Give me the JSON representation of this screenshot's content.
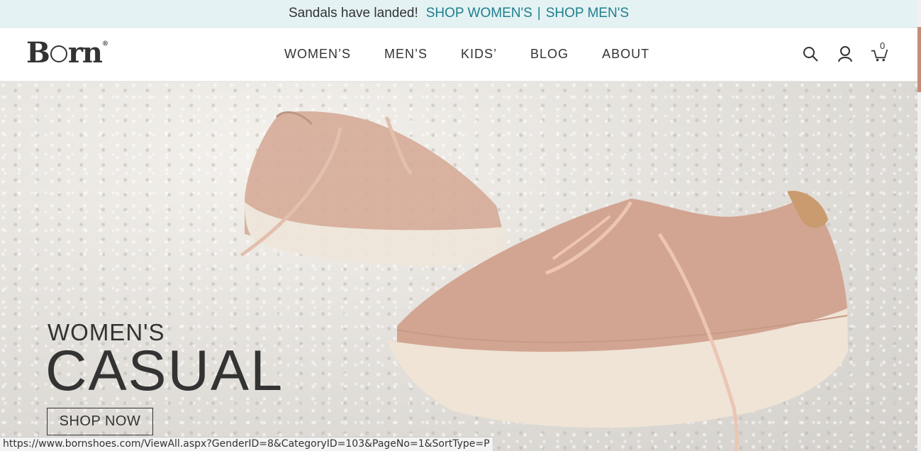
{
  "promo": {
    "message": "Sandals have landed!",
    "shop_womens": "SHOP WOMEN'S",
    "separator": "|",
    "shop_mens": "SHOP MEN'S"
  },
  "header": {
    "logo_left": "B",
    "logo_right": "rn",
    "logo_reg": "®",
    "nav": [
      "WOMEN’S",
      "MEN’S",
      "KIDS’",
      "BLOG",
      "ABOUT"
    ],
    "icons": [
      "search-icon",
      "account-icon",
      "cart-icon"
    ],
    "cart_count": "0"
  },
  "hero": {
    "subtitle": "WOMEN'S",
    "title": "CASUAL",
    "cta": "SHOP NOW"
  },
  "status_url": "https://www.bornshoes.com/ViewAll.aspx?GenderID=8&CategoryID=103&PageNo=1&SortType=P",
  "colors": {
    "promo_bg": "#e4f2f4",
    "promo_link": "#1f7f8c",
    "text": "#333333",
    "shoe": "#d2a592"
  }
}
